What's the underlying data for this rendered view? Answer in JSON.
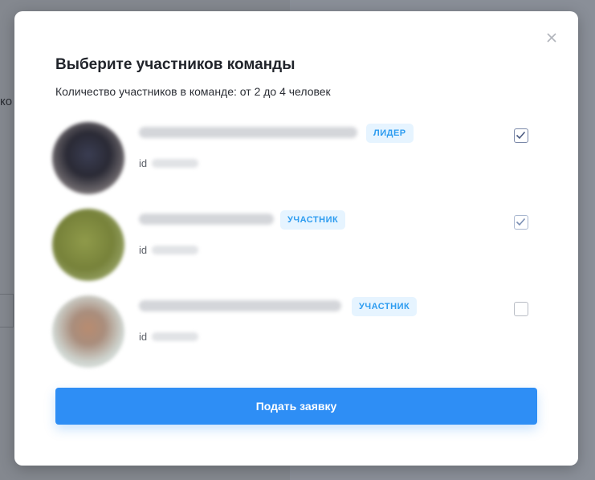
{
  "modal": {
    "title": "Выберите участников команды",
    "subtitle": "Количество участников в команде: от 2 до 4 человек",
    "submit_label": "Подать заявку",
    "close_icon": "close-icon"
  },
  "members": [
    {
      "role": "ЛИДЕР",
      "id_prefix": "id",
      "checked": true
    },
    {
      "role": "УЧАСТНИК",
      "id_prefix": "id",
      "checked": true
    },
    {
      "role": "УЧАСТНИК",
      "id_prefix": "id",
      "checked": false
    }
  ],
  "background": {
    "partial_text": "ко"
  },
  "colors": {
    "accent": "#2e8ef5",
    "badge_bg": "#e6f4ff",
    "badge_text": "#2d9cf0"
  }
}
